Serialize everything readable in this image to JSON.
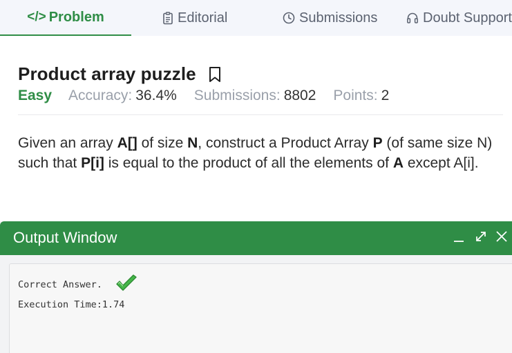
{
  "tabs": [
    {
      "label": "Problem",
      "icon": "code-icon",
      "active": true
    },
    {
      "label": "Editorial",
      "icon": "document-icon",
      "active": false
    },
    {
      "label": "Submissions",
      "icon": "clock-icon",
      "active": false
    },
    {
      "label": "Doubt Support",
      "icon": "headset-icon",
      "active": false
    }
  ],
  "problem": {
    "title": "Product array puzzle",
    "difficulty": "Easy",
    "accuracy_label": "Accuracy:",
    "accuracy_value": "36.4%",
    "submissions_label": "Submissions:",
    "submissions_value": "8802",
    "points_label": "Points:",
    "points_value": "2",
    "statement": {
      "p1": "Given an array ",
      "b1": "A[]",
      "p2": " of size ",
      "b2": "N",
      "p3": ", construct a Product Array ",
      "b3": "P",
      "p4": " (of same size N) such that ",
      "b4": "P[i]",
      "p5": " is equal to the product of all the elements of ",
      "b5": "A",
      "p6": " except A[i]."
    }
  },
  "output_window": {
    "title": "Output Window",
    "result_line": "Correct Answer.",
    "time_line": "Execution Time:1.74"
  },
  "colors": {
    "brand_green": "#2f8d46",
    "tab_bar_bg": "#f4f6fb",
    "muted_text": "#9aa0aa"
  }
}
